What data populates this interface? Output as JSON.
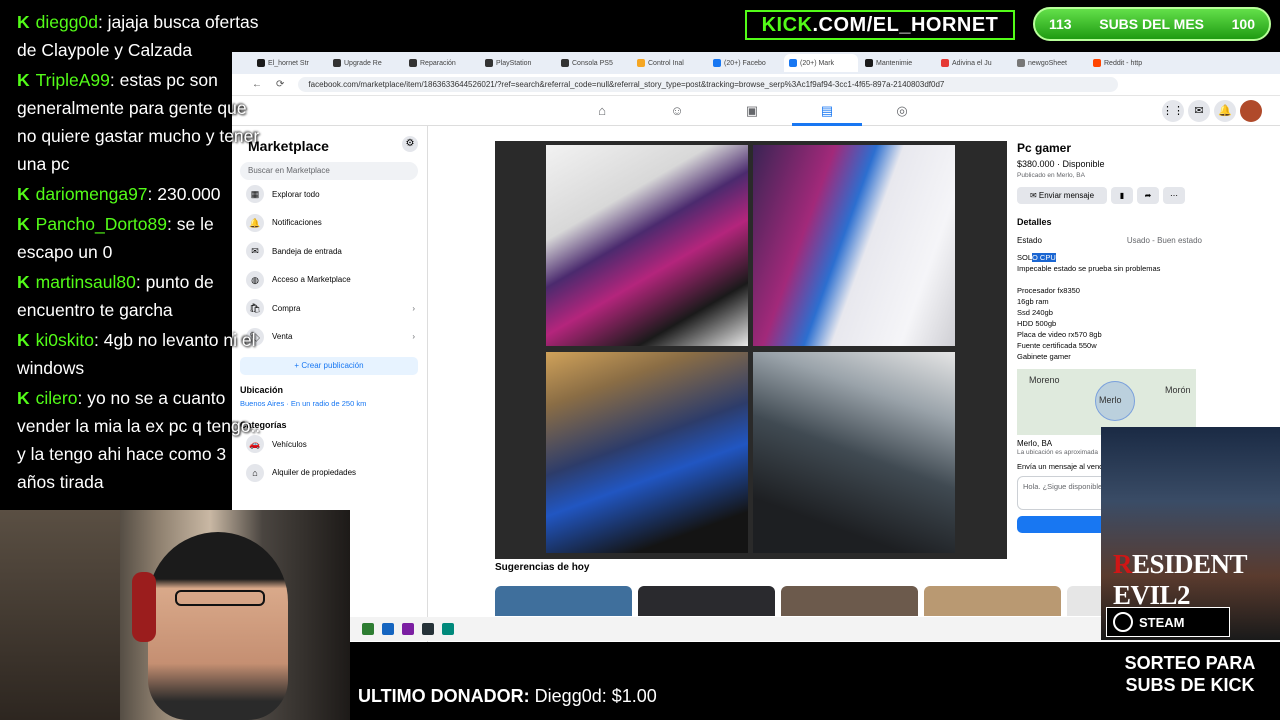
{
  "overlay": {
    "kick_url_prefix": "KICK",
    "kick_url_rest": ".COM/EL_HORNET",
    "subs_left": "113",
    "subs_label": "SUBS DEL MES",
    "subs_right": "100",
    "sorteo": "SORTEO PARA SUBS DE KICK",
    "donor_label": "ULTIMO DONADOR:",
    "donor_value": "Diegg0d: $1.00"
  },
  "chat": [
    {
      "user": "diegg0d",
      "text": ": jajaja busca ofertas de Claypole y Calzada"
    },
    {
      "user": "TripleA99",
      "text": ": estas pc son generalmente para gente que no quiere gastar mucho y tener una pc"
    },
    {
      "user": "dariomenga97",
      "text": ": 230.000"
    },
    {
      "user": "Pancho_Dorto89",
      "text": ": se le escapo un 0"
    },
    {
      "user": "martinsaul80",
      "text": ": punto de encuentro te garcha"
    },
    {
      "user": "ki0skito",
      "text": ": 4gb no levanto ni el windows"
    },
    {
      "user": "cilero",
      "text": ": yo no se a cuanto vender la mia la ex pc q tengo.. y la tengo ahi hace como 3 años tirada"
    }
  ],
  "browser": {
    "tabs": [
      "El_hornet Str",
      "Upgrade Re",
      "Reparación",
      "PlayStation",
      "Consola PS5",
      "Control Inal",
      "(20+) Facebo",
      "(20+) Mark",
      "Mantenimie",
      "Adivina el Ju",
      "newgoSheet",
      "Reddit - http"
    ],
    "url": "facebook.com/marketplace/item/1863633644526021/?ref=search&referral_code=null&referral_story_type=post&tracking=browse_serp%3Ac1f9af94-3cc1-4f65-897a-2140803df0d7"
  },
  "sidebar": {
    "title": "Marketplace",
    "search_placeholder": "Buscar en Marketplace",
    "items": [
      "Explorar todo",
      "Notificaciones",
      "Bandeja de entrada",
      "Acceso a Marketplace",
      "Compra",
      "Venta"
    ],
    "create_label": "+ Crear publicación",
    "location_heading": "Ubicación",
    "location_value": "Buenos Aires · En un radio de 250 km",
    "categories_heading": "Categorías",
    "cat_items": [
      "Vehículos",
      "Alquiler de propiedades"
    ]
  },
  "listing": {
    "title": "Pc gamer",
    "price": "$380.000 · Disponible",
    "published": "Publicado en Merlo, BA",
    "send_label": "Enviar mensaje",
    "details_heading": "Detalles",
    "estado_label": "Estado",
    "estado_value": "Usado - Buen estado",
    "solo_prefix": "SOL",
    "solo_highlight": "O CPU",
    "desc_line": "Impecable estado se prueba sin problemas",
    "specs": [
      "Procesador fx8350",
      "16gb ram",
      "Ssd 240gb",
      "HDD 500gb",
      "Placa de video rx570 8gb",
      "Fuente certificada 550w",
      "Gabinete gamer"
    ],
    "map_labels": [
      "Moreno",
      "Merlo",
      "Morón"
    ],
    "location": "Merlo, BA",
    "approx": "La ubicación es aproximada",
    "msg_heading": "Envía un mensaje al vendedor",
    "msg_placeholder": "Hola. ¿Sigue disponible?",
    "suggestions": "Sugerencias de hoy"
  },
  "ad": {
    "re_title_a": "R",
    "re_title_b": "ESIDENT E",
    "re_title_c": "VIL2",
    "steam": "STEAM"
  }
}
